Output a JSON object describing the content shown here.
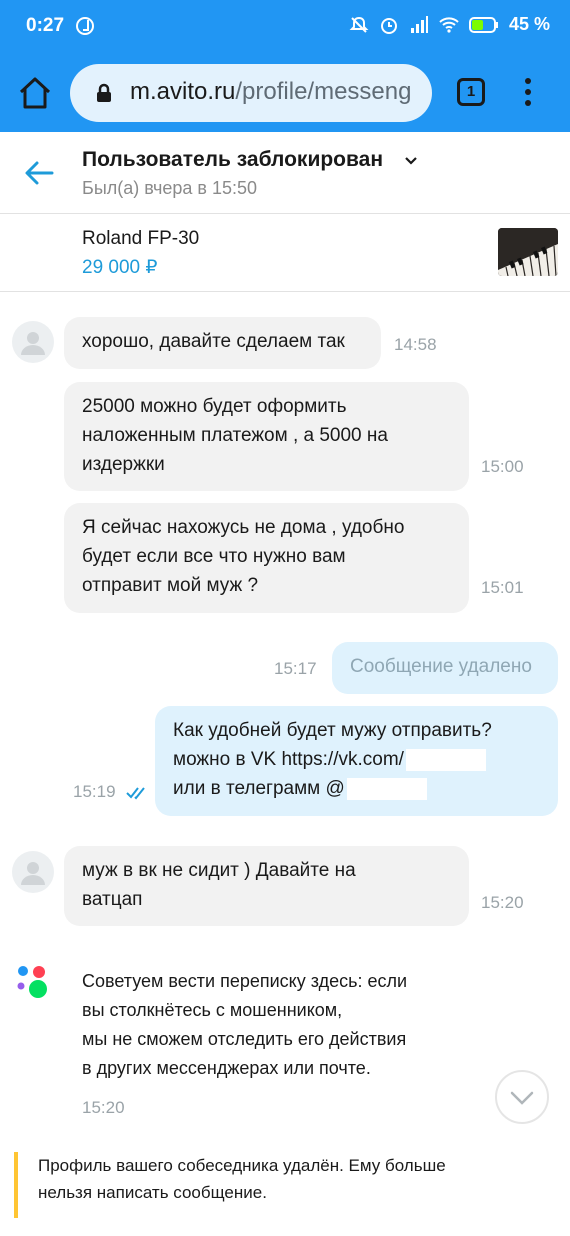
{
  "status_bar": {
    "time": "0:27",
    "battery_pct": "45 %",
    "icons": [
      "mute-icon",
      "alarm-icon",
      "signal-icon",
      "wifi-icon",
      "battery-icon"
    ]
  },
  "browser": {
    "url_host": "m.avito.ru",
    "url_path": "/profile/messeng",
    "tab_count": "1"
  },
  "chat": {
    "title": "Пользователь заблокирован",
    "subtitle": "Был(а) вчера в 15:50"
  },
  "ad": {
    "title": "Roland FP-30",
    "price": "29 000 ₽"
  },
  "messages": [
    {
      "direction": "in",
      "lines": [
        "хорошо, давайте сделаем так"
      ],
      "time": "14:58"
    },
    {
      "direction": "in",
      "lines": [
        "25000 можно будет оформить",
        "наложенным платежом , а 5000 на",
        "издержки"
      ],
      "time": "15:00"
    },
    {
      "direction": "in",
      "lines": [
        "Я сейчас нахожусь не дома , удобно",
        "будет если все что нужно вам",
        "отправит мой муж ?"
      ],
      "time": "15:01"
    },
    {
      "direction": "out",
      "lines": [
        "Сообщение удалено"
      ],
      "time": "15:17"
    },
    {
      "direction": "out",
      "lines": [
        "Как удобней будет мужу отправить?",
        "можно в VK https://vk.com/",
        "или в телеграмм @"
      ],
      "time": "15:19"
    },
    {
      "direction": "in",
      "lines": [
        "муж в вк не сидит ) Давайте на",
        "ватцап"
      ],
      "time": "15:20"
    }
  ],
  "system_notice": {
    "lines": [
      "Советуем вести переписку здесь: если",
      "вы столкнётесь с мошенником,",
      "мы не сможем отследить его действия",
      "в других мессенджерах или почте."
    ],
    "time": "15:20"
  },
  "footer": {
    "lines": [
      "Профиль вашего собеседника удалён. Ему больше",
      "нельзя написать сообщение."
    ]
  },
  "colors": {
    "browser_bar": "#2196f3",
    "accent": "#1e9bd9",
    "incoming_bubble": "#f2f2f2",
    "outgoing_bubble": "#dff2fd",
    "footer_accent": "#ffc533"
  }
}
